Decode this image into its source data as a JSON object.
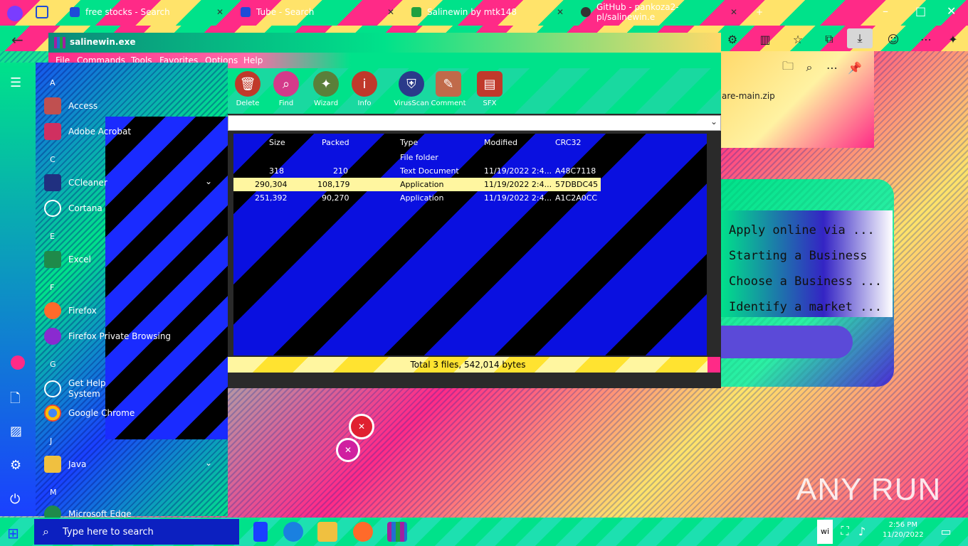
{
  "browser": {
    "tabs": [
      {
        "label": "free stocks - Search"
      },
      {
        "label": "Tube - Search"
      },
      {
        "label": "Salinewin by mtk148"
      },
      {
        "label": "GitHub - pankoza2-pl/salinewin.e"
      }
    ],
    "new_tab": "+"
  },
  "downloads": {
    "file": "are-main.zip"
  },
  "webpage": {
    "lines": [
      "Apply online via ...",
      "Starting a Business",
      "Choose a Business ...",
      "Identify a market ..."
    ]
  },
  "winrar": {
    "title": "salinewin.exe",
    "menu": [
      "File",
      "Commands",
      "Tools",
      "Favorites",
      "Options",
      "Help"
    ],
    "tools": [
      "Delete",
      "Find",
      "Wizard",
      "Info",
      "VirusScan",
      "Comment",
      "SFX"
    ],
    "columns": [
      "Size",
      "Packed",
      "Type",
      "Modified",
      "CRC32"
    ],
    "rows": [
      {
        "size": "",
        "packed": "",
        "type": "File folder",
        "modified": "",
        "crc": ""
      },
      {
        "size": "318",
        "packed": "210",
        "type": "Text Document",
        "modified": "11/19/2022 2:4...",
        "crc": "A48C7118"
      },
      {
        "size": "290,304",
        "packed": "108,179",
        "type": "Application",
        "modified": "11/19/2022 2:4...",
        "crc": "57DBDC45"
      },
      {
        "size": "251,392",
        "packed": "90,270",
        "type": "Application",
        "modified": "11/19/2022 2:4...",
        "crc": "A1C2A0CC"
      }
    ],
    "status": "Total 3 files, 542,014 bytes"
  },
  "start_menu": {
    "letters": [
      "A",
      "C",
      "E",
      "F",
      "G",
      "J",
      "M"
    ],
    "apps": [
      {
        "label": "Access"
      },
      {
        "label": "Adobe Acrobat"
      },
      {
        "label": "CCleaner"
      },
      {
        "label": "Cortana"
      },
      {
        "label": "Excel"
      },
      {
        "label": "Firefox"
      },
      {
        "label": "Firefox Private Browsing"
      },
      {
        "label": "Get Help",
        "sub": "System"
      },
      {
        "label": "Google Chrome"
      },
      {
        "label": "Java"
      },
      {
        "label": "Microsoft Edge"
      }
    ]
  },
  "watermark": "ANY RUN",
  "taskbar": {
    "search_placeholder": "Type here to search",
    "tray_label": "wi",
    "time": "2:56 PM",
    "date": "11/20/2022"
  }
}
